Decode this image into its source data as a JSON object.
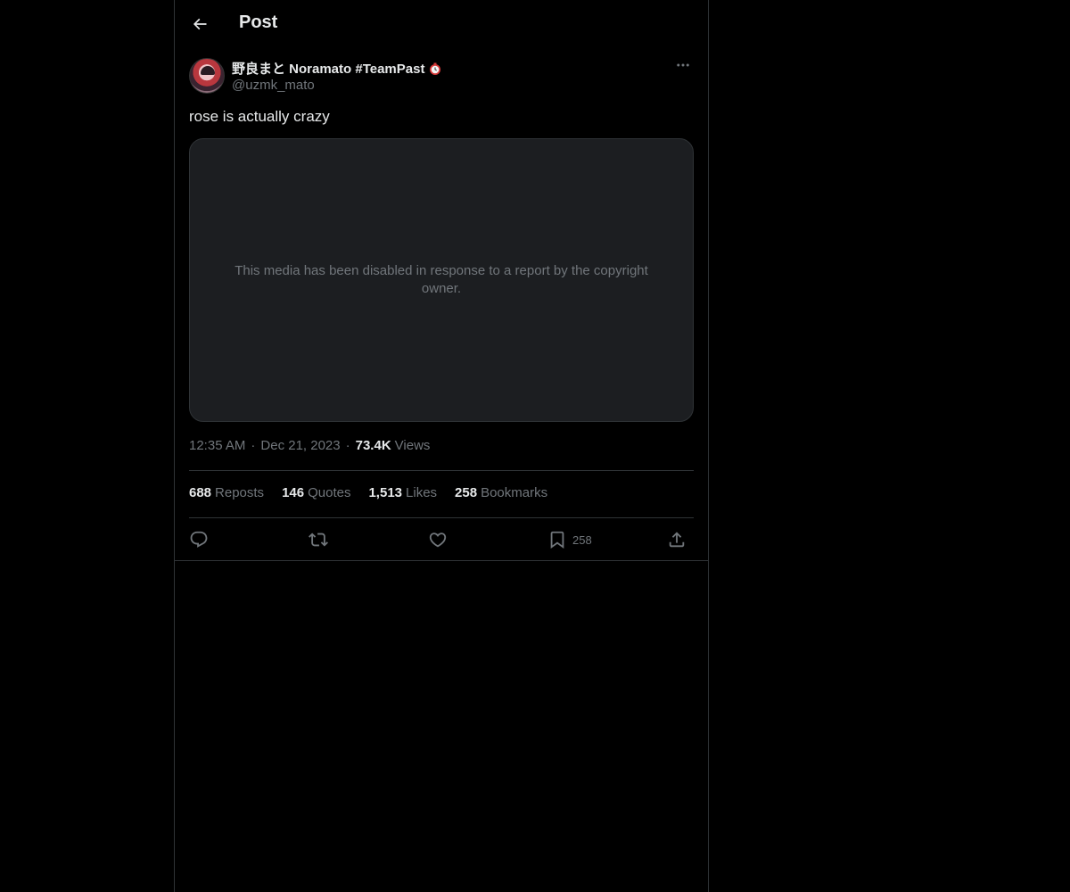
{
  "header": {
    "title": "Post"
  },
  "post": {
    "author": {
      "display_name": "野良まと Noramato #TeamPast",
      "handle": "@uzmk_mato"
    },
    "text": "rose is actually crazy",
    "media_message": "This media has been disabled in response to a report by the copyright owner.",
    "time": "12:35 AM",
    "date": "Dec 21, 2023",
    "views_count": "73.4K",
    "views_label": "Views"
  },
  "stats": {
    "reposts": {
      "count": "688",
      "label": "Reposts"
    },
    "quotes": {
      "count": "146",
      "label": "Quotes"
    },
    "likes": {
      "count": "1,513",
      "label": "Likes"
    },
    "bookmarks": {
      "count": "258",
      "label": "Bookmarks"
    }
  },
  "actions": {
    "bookmark_count": "258"
  },
  "colors": {
    "background": "#000000",
    "text": "#e7e9ea",
    "muted": "#71767b",
    "border": "#2f3336",
    "media_bg": "#1c1e21"
  },
  "icons": [
    "back-arrow-icon",
    "avatar",
    "clock-emoji-icon",
    "more-icon",
    "reply-icon",
    "repost-icon",
    "like-icon",
    "bookmark-icon",
    "share-icon"
  ]
}
